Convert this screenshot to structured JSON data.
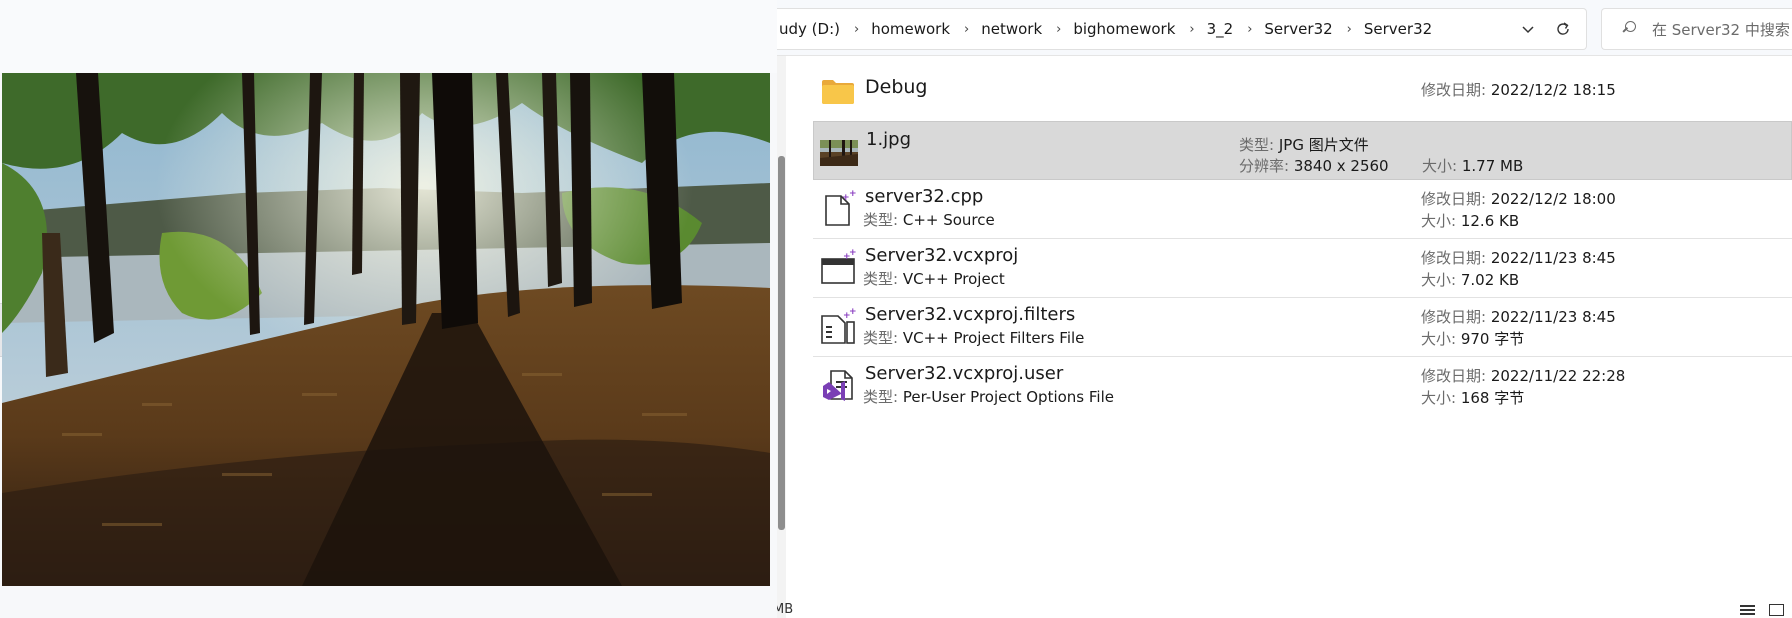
{
  "address_bar": {
    "crumbs": [
      "udy (D:)",
      "homework",
      "network",
      "bighomework",
      "3_2",
      "Server32",
      "Server32"
    ],
    "separator": "›"
  },
  "search": {
    "placeholder": "在 Server32 中搜索"
  },
  "files": [
    {
      "name": "Debug",
      "kind": "folder",
      "icon": "folder-icon",
      "modified_label": "修改日期:",
      "modified": "2022/12/2 18:15"
    },
    {
      "name": "1.jpg",
      "kind": "image",
      "icon": "image-thumbnail-icon",
      "selected": true,
      "type_label": "类型:",
      "type": "JPG 图片文件",
      "res_label": "分辨率:",
      "resolution": "3840 x 2560",
      "size_label": "大小:",
      "size": "1.77 MB"
    },
    {
      "name": "server32.cpp",
      "kind": "file",
      "icon": "cpp-file-icon",
      "type_label": "类型:",
      "type": "C++ Source",
      "modified_label": "修改日期:",
      "modified": "2022/12/2 18:00",
      "size_label": "大小:",
      "size": "12.6 KB"
    },
    {
      "name": "Server32.vcxproj",
      "kind": "file",
      "icon": "vcxproj-file-icon",
      "type_label": "类型:",
      "type": "VC++ Project",
      "modified_label": "修改日期:",
      "modified": "2022/11/23 8:45",
      "size_label": "大小:",
      "size": "7.02 KB"
    },
    {
      "name": "Server32.vcxproj.filters",
      "kind": "file",
      "icon": "filters-file-icon",
      "type_label": "类型:",
      "type": "VC++ Project Filters File",
      "modified_label": "修改日期:",
      "modified": "2022/11/23 8:45",
      "size_label": "大小:",
      "size": "970 字节"
    },
    {
      "name": "Server32.vcxproj.user",
      "kind": "file",
      "icon": "visual-studio-user-file-icon",
      "type_label": "类型:",
      "type": "Per-User Project Options File",
      "modified_label": "修改日期:",
      "modified": "2022/11/22 22:28",
      "size_label": "大小:",
      "size": "168 字节"
    }
  ],
  "status_fragment": "MB",
  "colors": {
    "selection": "#d9d9d9",
    "folder": "#f4c144",
    "vs_purple": "#7a3fb5"
  }
}
